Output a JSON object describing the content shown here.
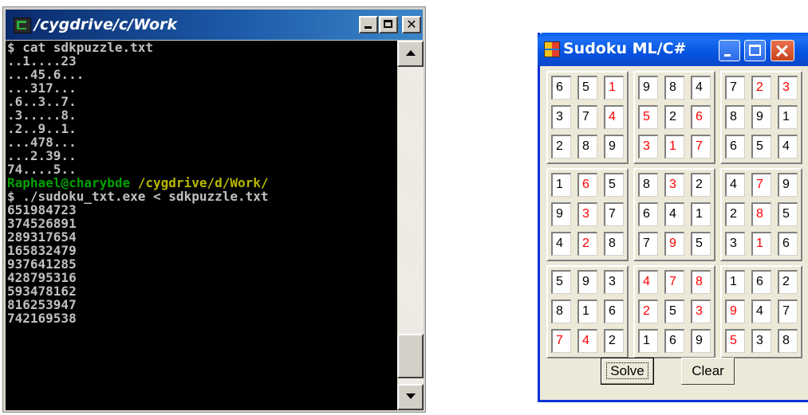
{
  "terminal": {
    "title": "/cygdrive/c/Work",
    "lines": [
      {
        "text": "$ cat sdkpuzzle.txt",
        "style": "normal"
      },
      {
        "text": "..1....23",
        "style": "normal"
      },
      {
        "text": "...45.6...",
        "style": "normal"
      },
      {
        "text": "...317...",
        "style": "normal"
      },
      {
        "text": ".6..3..7.",
        "style": "normal"
      },
      {
        "text": ".3.....8.",
        "style": "normal"
      },
      {
        "text": ".2..9..1.",
        "style": "normal"
      },
      {
        "text": "...478...",
        "style": "normal"
      },
      {
        "text": "...2.39..",
        "style": "normal"
      },
      {
        "text": "74....5..",
        "style": "normal"
      },
      {
        "text": "Raphael@charybde",
        "path": " /cygdrive/d/Work/",
        "style": "prompt"
      },
      {
        "text": "$ ./sudoku_txt.exe < sdkpuzzle.txt",
        "style": "normal"
      },
      {
        "text": "651984723",
        "style": "normal"
      },
      {
        "text": "374526891",
        "style": "normal"
      },
      {
        "text": "289317654",
        "style": "normal"
      },
      {
        "text": "165832479",
        "style": "normal"
      },
      {
        "text": "937641285",
        "style": "normal"
      },
      {
        "text": "428795316",
        "style": "normal"
      },
      {
        "text": "593478162",
        "style": "normal"
      },
      {
        "text": "816253947",
        "style": "normal"
      },
      {
        "text": "742169538",
        "style": "normal"
      }
    ]
  },
  "sudoku": {
    "title": "Sudoku ML/C#",
    "colors": {
      "given": "#ff0000",
      "solved": "#000000"
    },
    "rows": [
      [
        "6",
        "5",
        "1",
        "9",
        "8",
        "4",
        "7",
        "2",
        "3"
      ],
      [
        "3",
        "7",
        "4",
        "5",
        "2",
        "6",
        "8",
        "9",
        "1"
      ],
      [
        "2",
        "8",
        "9",
        "3",
        "1",
        "7",
        "6",
        "5",
        "4"
      ],
      [
        "1",
        "6",
        "5",
        "8",
        "3",
        "2",
        "4",
        "7",
        "9"
      ],
      [
        "9",
        "3",
        "7",
        "6",
        "4",
        "1",
        "2",
        "8",
        "5"
      ],
      [
        "4",
        "2",
        "8",
        "7",
        "9",
        "5",
        "3",
        "1",
        "6"
      ],
      [
        "5",
        "9",
        "3",
        "4",
        "7",
        "8",
        "1",
        "6",
        "2"
      ],
      [
        "8",
        "1",
        "6",
        "2",
        "5",
        "3",
        "9",
        "4",
        "7"
      ],
      [
        "7",
        "4",
        "2",
        "1",
        "6",
        "9",
        "5",
        "3",
        "8"
      ]
    ],
    "given_mask": [
      [
        0,
        0,
        1,
        0,
        0,
        0,
        0,
        1,
        1
      ],
      [
        0,
        0,
        1,
        1,
        0,
        1,
        0,
        0,
        0
      ],
      [
        0,
        0,
        0,
        1,
        1,
        1,
        0,
        0,
        0
      ],
      [
        0,
        1,
        0,
        0,
        1,
        0,
        0,
        1,
        0
      ],
      [
        0,
        1,
        0,
        0,
        0,
        0,
        0,
        1,
        0
      ],
      [
        0,
        1,
        0,
        0,
        1,
        0,
        0,
        1,
        0
      ],
      [
        0,
        0,
        0,
        1,
        1,
        1,
        0,
        0,
        0
      ],
      [
        0,
        0,
        0,
        1,
        0,
        1,
        1,
        0,
        0
      ],
      [
        1,
        1,
        0,
        0,
        0,
        0,
        1,
        0,
        0
      ]
    ],
    "buttons": {
      "solve": "Solve",
      "clear": "Clear"
    }
  }
}
